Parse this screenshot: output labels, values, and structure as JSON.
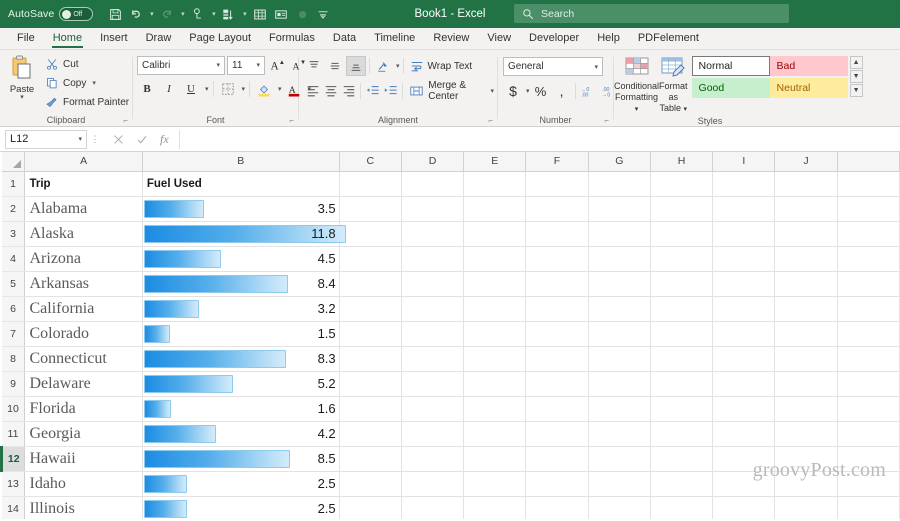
{
  "titlebar": {
    "autosave_label": "AutoSave",
    "autosave_state": "Off",
    "document_title": "Book1  -  Excel",
    "qat": [
      {
        "name": "save-icon",
        "label": "Save"
      },
      {
        "name": "undo-icon",
        "label": "Undo"
      },
      {
        "name": "redo-icon",
        "label": "Redo"
      },
      {
        "name": "touch-mode-icon",
        "label": "Touch/Mouse Mode"
      },
      {
        "name": "sort-filter-icon",
        "label": "Sort and Filter"
      },
      {
        "name": "table-icon",
        "label": "Table"
      },
      {
        "name": "print-preview-icon",
        "label": "Print Preview"
      },
      {
        "name": "record-icon",
        "label": "Record Macro"
      },
      {
        "name": "customize-qat-icon",
        "label": "Customize Quick Access Toolbar"
      }
    ],
    "search_placeholder": "Search",
    "search_icon": "search-icon"
  },
  "tabs": [
    {
      "label": "File",
      "active": false
    },
    {
      "label": "Home",
      "active": true
    },
    {
      "label": "Insert",
      "active": false
    },
    {
      "label": "Draw",
      "active": false
    },
    {
      "label": "Page Layout",
      "active": false
    },
    {
      "label": "Formulas",
      "active": false
    },
    {
      "label": "Data",
      "active": false
    },
    {
      "label": "Timeline",
      "active": false
    },
    {
      "label": "Review",
      "active": false
    },
    {
      "label": "View",
      "active": false
    },
    {
      "label": "Developer",
      "active": false
    },
    {
      "label": "Help",
      "active": false
    },
    {
      "label": "PDFelement",
      "active": false
    }
  ],
  "ribbon": {
    "clipboard": {
      "group_label": "Clipboard",
      "paste_label": "Paste",
      "cut_label": "Cut",
      "copy_label": "Copy",
      "format_painter_label": "Format Painter"
    },
    "font": {
      "group_label": "Font",
      "font_name": "Calibri",
      "font_size": "11",
      "grow_font": "A",
      "shrink_font": "A",
      "bold": "B",
      "italic": "I",
      "underline": "U"
    },
    "alignment": {
      "group_label": "Alignment",
      "wrap_text_label": "Wrap Text",
      "merge_center_label": "Merge & Center"
    },
    "number": {
      "group_label": "Number",
      "format": "General",
      "currency": "$",
      "percent": "%",
      "comma": ","
    },
    "styles": {
      "group_label": "Styles",
      "conditional_formatting_line1": "Conditional",
      "conditional_formatting_line2": "Formatting",
      "format_as_table_line1": "Format as",
      "format_as_table_line2": "Table",
      "gallery": [
        {
          "label": "Normal",
          "color": "#ffffff"
        },
        {
          "label": "Bad",
          "color": "#ffc7ce"
        },
        {
          "label": "Good",
          "color": "#c6efce"
        },
        {
          "label": "Neutral",
          "color": "#ffeb9c"
        }
      ]
    }
  },
  "formula_bar": {
    "name_box": "L12",
    "cancel_icon": "close-icon",
    "enter_icon": "check-icon",
    "function_icon": "fx-icon",
    "formula_value": ""
  },
  "sheet": {
    "columns": [
      "A",
      "B",
      "C",
      "D",
      "E",
      "F",
      "G",
      "H",
      "I",
      "J"
    ],
    "active_row": 12,
    "header_row": {
      "row": 1,
      "a": "Trip",
      "b": "Fuel Used"
    },
    "rows": [
      {
        "row": 2,
        "trip": "Alabama",
        "fuel": "3.5"
      },
      {
        "row": 3,
        "trip": "Alaska",
        "fuel": "11.8"
      },
      {
        "row": 4,
        "trip": "Arizona",
        "fuel": "4.5"
      },
      {
        "row": 5,
        "trip": "Arkansas",
        "fuel": "8.4"
      },
      {
        "row": 6,
        "trip": "California",
        "fuel": "3.2"
      },
      {
        "row": 7,
        "trip": "Colorado",
        "fuel": "1.5"
      },
      {
        "row": 8,
        "trip": "Connecticut",
        "fuel": "8.3"
      },
      {
        "row": 9,
        "trip": "Delaware",
        "fuel": "5.2"
      },
      {
        "row": 10,
        "trip": "Florida",
        "fuel": "1.6"
      },
      {
        "row": 11,
        "trip": "Georgia",
        "fuel": "4.2"
      },
      {
        "row": 12,
        "trip": "Hawaii",
        "fuel": "8.5"
      },
      {
        "row": 13,
        "trip": "Idaho",
        "fuel": "2.5"
      },
      {
        "row": 14,
        "trip": "Illinois",
        "fuel": "2.5"
      }
    ],
    "watermark": "groovyPost.com"
  },
  "chart_data": {
    "type": "bar",
    "title": "Fuel Used",
    "xlabel": "Trip",
    "ylabel": "Fuel Used",
    "categories": [
      "Alabama",
      "Alaska",
      "Arizona",
      "Arkansas",
      "California",
      "Colorado",
      "Connecticut",
      "Delaware",
      "Florida",
      "Georgia",
      "Hawaii",
      "Idaho",
      "Illinois"
    ],
    "values": [
      3.5,
      11.8,
      4.5,
      8.4,
      3.2,
      1.5,
      8.3,
      5.2,
      1.6,
      4.2,
      8.5,
      2.5,
      2.5
    ],
    "max_value": 11.8,
    "bar_color_start": "#1b8ce3",
    "bar_color_end": "#d4ebfa",
    "grid": false,
    "legend": "none",
    "note": "Excel conditional-formatting gradient data bars drawn in-cell in column B"
  },
  "colors": {
    "brand_green": "#217346",
    "ribbon_bg": "#f3f2f1",
    "bar_blue": "#1b8ce3",
    "bad": "#ffc7ce",
    "good": "#c6efce",
    "neutral": "#ffeb9c"
  }
}
